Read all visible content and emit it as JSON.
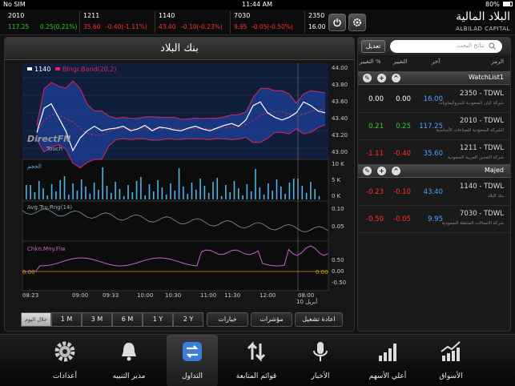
{
  "statusbar": {
    "carrier": "No SIM",
    "time": "11:44 AM",
    "battery": "80%"
  },
  "tickers": [
    {
      "symbol": "2010",
      "price": "117.25",
      "change": "0.25(0.21%)",
      "dir": "up"
    },
    {
      "symbol": "1211",
      "price": "35.60",
      "change": "-0.40(-1.11%)",
      "dir": "down"
    },
    {
      "symbol": "1140",
      "price": "43.40",
      "change": "-0.10(-0.23%)",
      "dir": "down"
    },
    {
      "symbol": "7030",
      "price": "9.95",
      "change": "-0.05(-0.50%)",
      "dir": "down"
    },
    {
      "symbol": "2350",
      "price": "16.00",
      "change": "",
      "dir": "flat"
    }
  ],
  "logo": {
    "arabic": "البلاد المالية",
    "english": "ALBILAD CAPITAL"
  },
  "chart": {
    "title": "بنك البلاد",
    "legend_symbol": "1140",
    "legend_indicator": "Blngr.Band(20,2)",
    "watermark_line1": "DirectFN",
    "watermark_line2": "Touch",
    "volume_label": "الحجم",
    "atr_label": "Avg.Tru.Rng(14)",
    "cmf_label": "Chkn.Mny.Flw",
    "x_ticks": [
      "08:23",
      "09:00",
      "09:33",
      "10:00",
      "10:30",
      "11:00",
      "11:30",
      "12:00",
      "08:00"
    ],
    "x_date_label": "10 أبريل",
    "price_ticks": [
      "44.00",
      "43.80",
      "43.60",
      "43.40",
      "43.20",
      "43.00"
    ],
    "volume_ticks": [
      "10 K",
      "5 K",
      "0 K"
    ],
    "atr_ticks": [
      "0.10",
      "0.05"
    ],
    "cmf_ticks": [
      "0.50",
      "0.00",
      "-0.50"
    ],
    "cmf_marker": "0.00"
  },
  "chart_data": {
    "type": "line",
    "title": "بنك البلاد",
    "series": [
      {
        "name": "1140",
        "values": [
          43.28,
          43.55,
          43.6,
          43.45,
          43.3,
          43.08,
          43.22,
          43.3,
          43.35,
          43.3,
          43.32,
          43.33,
          43.35,
          43.3,
          43.32,
          43.36,
          43.3,
          43.34,
          43.33,
          43.31,
          43.3,
          43.33,
          43.35,
          43.32,
          43.3,
          43.33,
          43.36,
          43.38,
          43.35,
          43.42,
          43.58,
          43.62,
          43.5,
          43.45,
          43.42,
          43.45,
          43.5,
          43.62,
          43.58,
          43.52,
          43.5
        ]
      },
      {
        "name": "Blngr.Band(20,2)",
        "values": []
      }
    ],
    "ylim": [
      43.0,
      44.05
    ]
  },
  "rangebuttons": [
    "خلال اليوم",
    "1 M",
    "3 M",
    "6 M",
    "1 Y",
    "2 Y"
  ],
  "actions": {
    "options": "خيارات",
    "indicators": "مؤشرات",
    "replay": "اعادة تشغيل"
  },
  "watchlist": {
    "search_placeholder": "نتائج البحث",
    "edit_label": "تعديل",
    "columns": {
      "symbol": "الرمز",
      "last": "آخر",
      "change": "التغيير",
      "pct": "التغيير %"
    },
    "lists": [
      {
        "name": "WatchList1",
        "rows": [
          {
            "symbol": "2350 - TDWL",
            "desc": "شركة كيان السعودية للبتروكيماويات",
            "last": "16.00",
            "change": "0.00",
            "pct": "0.00",
            "dir": "flat"
          },
          {
            "symbol": "2010 - TDWL",
            "desc": "الشركة السعودية للصناعات الأساسية",
            "last": "117.25",
            "change": "0.25",
            "pct": "0.21",
            "dir": "up"
          },
          {
            "symbol": "1211 - TDWL",
            "desc": "شركة التعدين العربية السعودية",
            "last": "35.60",
            "change": "-0.40",
            "pct": "-1.11",
            "dir": "down"
          }
        ]
      },
      {
        "name": "Majed",
        "rows": [
          {
            "symbol": "1140 - TDWL",
            "desc": "بنك البلاد",
            "last": "43.40",
            "change": "-0.10",
            "pct": "-0.23",
            "dir": "down"
          },
          {
            "symbol": "7030 - TDWL",
            "desc": "شركة الاتصالات المتنقلة السعودية",
            "last": "9.95",
            "change": "-0.05",
            "pct": "-0.50",
            "dir": "down"
          }
        ]
      }
    ]
  },
  "tabs": [
    {
      "label": "أعدادات",
      "icon": "gear-icon"
    },
    {
      "label": "مدير التنبيه",
      "icon": "bell-icon"
    },
    {
      "label": "التداول",
      "icon": "exchange-icon",
      "active": true
    },
    {
      "label": "قوائم المتابعة",
      "icon": "sort-arrows-icon"
    },
    {
      "label": "الأخبار",
      "icon": "microphone-icon"
    },
    {
      "label": "أعلي الأسهم",
      "icon": "bar-chart-icon"
    },
    {
      "label": "الأسواق",
      "icon": "market-chart-icon"
    }
  ],
  "colors": {
    "up": "#2ecc2e",
    "down": "#ff3030",
    "flat": "#ffffff",
    "link": "#4aa3ff"
  }
}
